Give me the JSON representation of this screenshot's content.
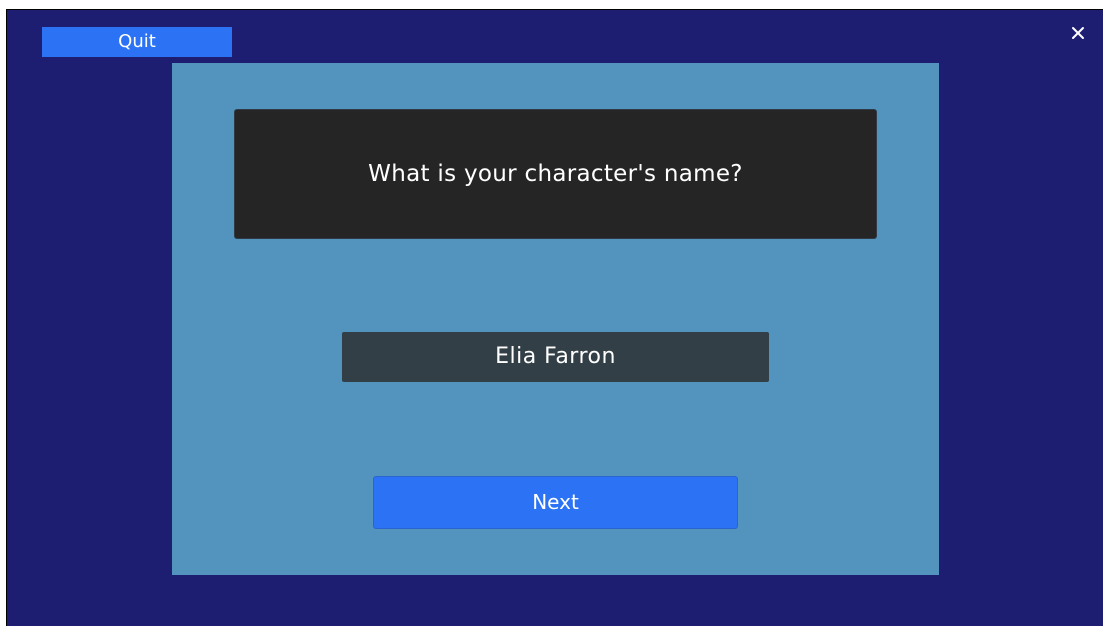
{
  "toolbar": {
    "quit_label": "Quit",
    "close_icon": "close-icon"
  },
  "question": {
    "text": "What is your character's name?"
  },
  "name_input": {
    "value": "Elia Farron"
  },
  "actions": {
    "next_label": "Next"
  },
  "colors": {
    "background": "#1d1e72",
    "panel": "#5394bf",
    "question_box": "#252525",
    "input": "#333f47",
    "accent_button": "#2b72f5",
    "text": "#ffffff"
  }
}
